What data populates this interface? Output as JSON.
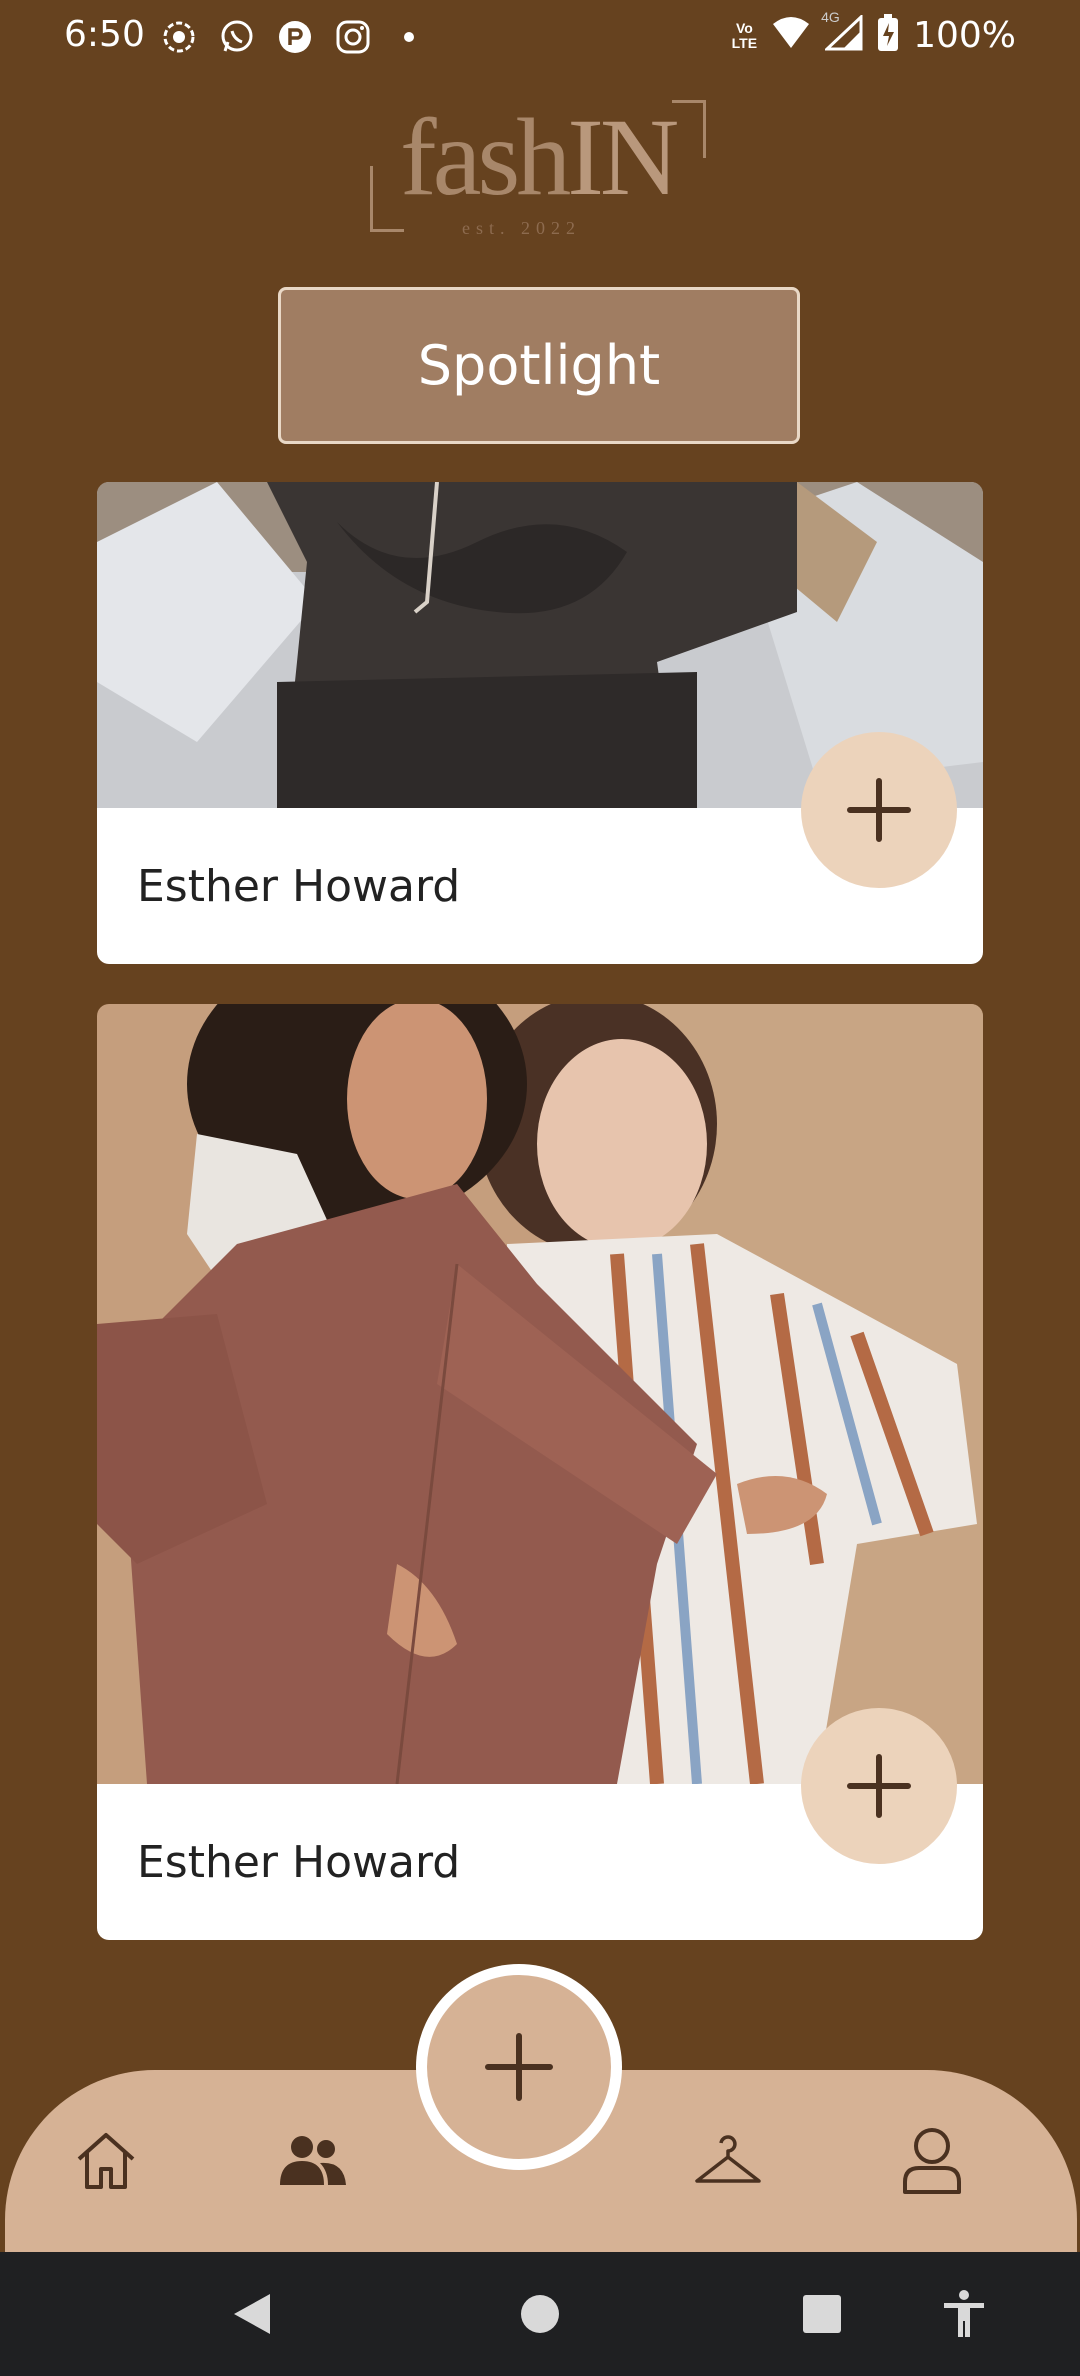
{
  "status_bar": {
    "time": "6:50",
    "battery": "100%",
    "network": "4G",
    "volte": "Vo LTE",
    "left_icons": [
      "screen-record-icon",
      "whatsapp-icon",
      "app-r-icon",
      "instagram-icon",
      "dot-icon"
    ]
  },
  "logo": {
    "word_left": "fash",
    "word_right": "IN",
    "tagline": "est. 2022"
  },
  "spotlight": {
    "label": "Spotlight"
  },
  "cards": [
    {
      "name": "Esther Howard",
      "add_icon": "plus-icon"
    },
    {
      "name": "Esther Howard",
      "add_icon": "plus-icon"
    }
  ],
  "bottom_nav": {
    "items": [
      "home-icon",
      "people-icon",
      "add-icon",
      "hanger-icon",
      "profile-icon"
    ]
  },
  "system_nav": [
    "back-icon",
    "home-circle-icon",
    "recents-icon",
    "accessibility-icon"
  ],
  "colors": {
    "background": "#66421f",
    "nav": "#d6b295",
    "button": "#a07d62",
    "add_circle": "#ecd3bb",
    "icon_dark": "#4a3120"
  }
}
